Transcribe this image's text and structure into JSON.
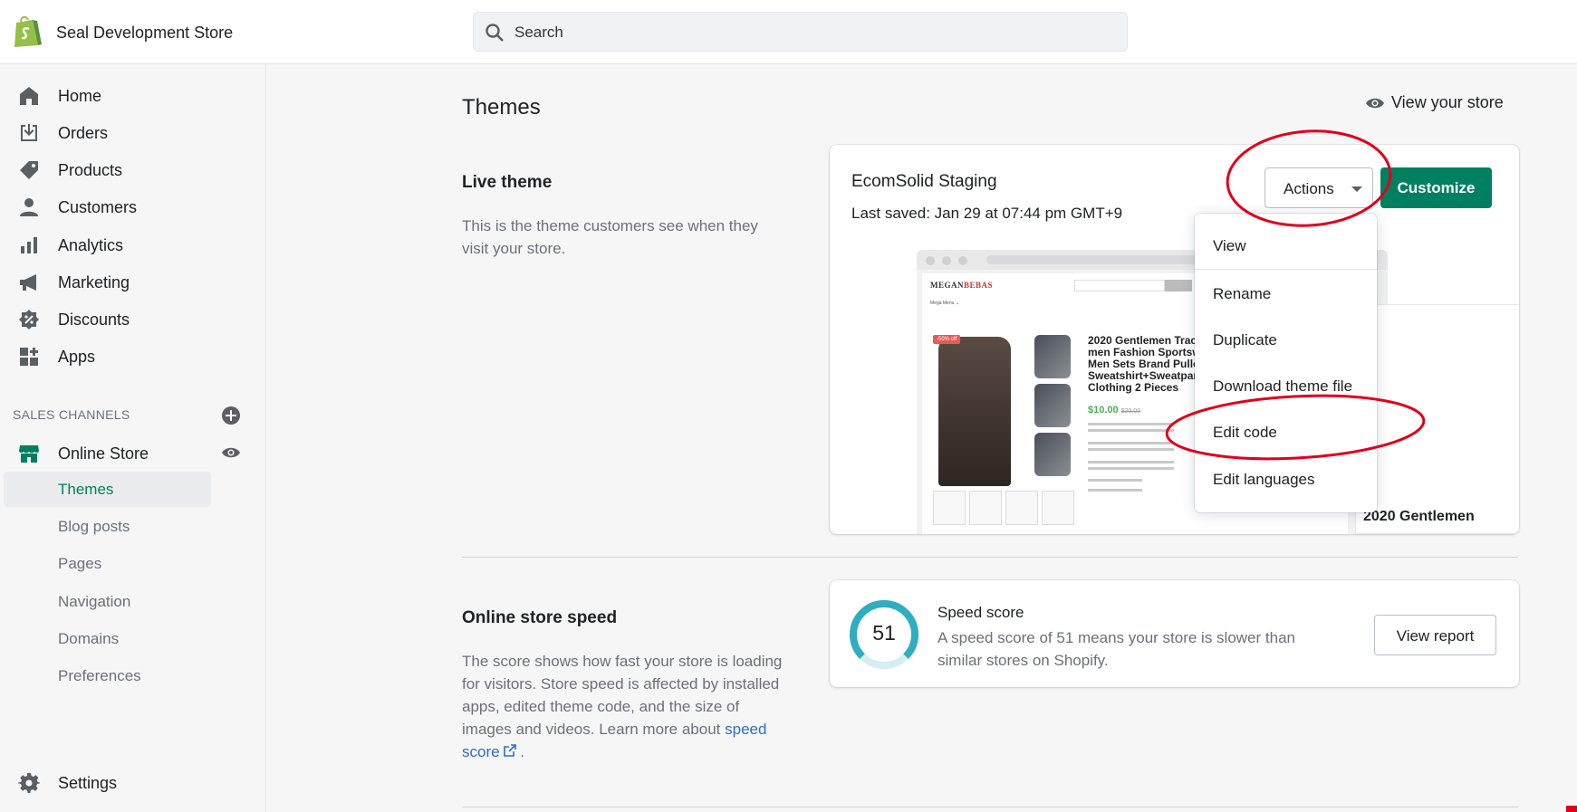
{
  "header": {
    "store_name": "Seal Development Store",
    "search_placeholder": "Search"
  },
  "sidebar": {
    "items": [
      {
        "label": "Home",
        "icon": "home-icon"
      },
      {
        "label": "Orders",
        "icon": "orders-icon"
      },
      {
        "label": "Products",
        "icon": "tag-icon"
      },
      {
        "label": "Customers",
        "icon": "person-icon"
      },
      {
        "label": "Analytics",
        "icon": "bar-chart-icon"
      },
      {
        "label": "Marketing",
        "icon": "megaphone-icon"
      },
      {
        "label": "Discounts",
        "icon": "discount-icon"
      },
      {
        "label": "Apps",
        "icon": "apps-icon"
      }
    ],
    "sales_channels_title": "SALES CHANNELS",
    "online_store": "Online Store",
    "sub_items": [
      "Themes",
      "Blog posts",
      "Pages",
      "Navigation",
      "Domains",
      "Preferences"
    ],
    "settings": "Settings"
  },
  "page": {
    "title": "Themes",
    "view_store": "View your store"
  },
  "live_theme": {
    "heading": "Live theme",
    "description": "This is the theme customers see when they visit your store.",
    "theme_name": "EcomSolid Staging",
    "last_saved": "Last saved: Jan 29 at 07:44 pm GMT+9",
    "actions_label": "Actions",
    "customize_label": "Customize"
  },
  "preview": {
    "brand_a": "MEGAN",
    "brand_b": "BEBAS",
    "menu": "Mega Menu ⌄",
    "sale": "-50% off",
    "product_title": "2020 Gentlemen Tracksuit men Fashion Sportswear Men Sets Brand Pullover Sweatshirt+Sweatpants Clothing 2 Pieces",
    "price": "$10.00",
    "old_price": "$20.00",
    "side_title": "2020 Gentlemen"
  },
  "actions_menu": [
    "View",
    "Rename",
    "Duplicate",
    "Download theme file",
    "Edit code",
    "Edit languages"
  ],
  "speed": {
    "heading": "Online store speed",
    "description": "The score shows how fast your store is loading for visitors. Store speed is affected by installed apps, edited theme code, and the size of images and videos. Learn more about",
    "link": "speed score",
    "score": "51",
    "score_fraction": 0.51,
    "card_title": "Speed score",
    "card_desc": "A speed score of 51 means your store is slower than similar stores on Shopify.",
    "report_label": "View report"
  },
  "colors": {
    "accent_green": "#008060",
    "annotation_red": "#e0001b",
    "gauge_teal": "#2eaec1"
  }
}
